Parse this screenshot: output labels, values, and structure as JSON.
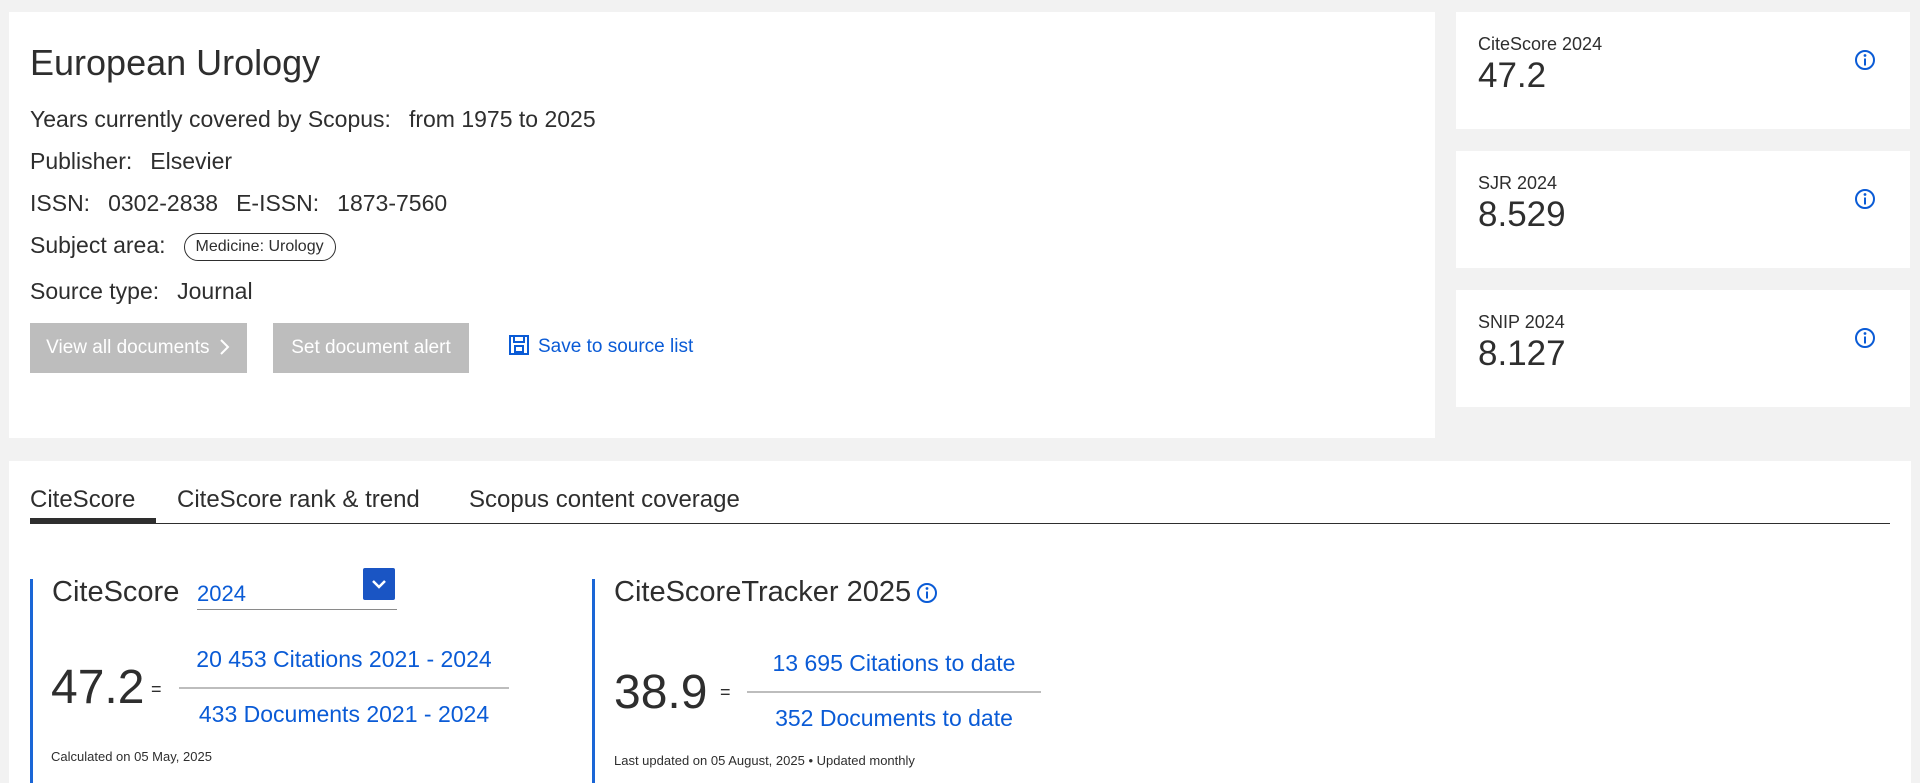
{
  "source": {
    "title": "European Urology",
    "years_label": "Years currently covered by Scopus:",
    "years_value": "from 1975 to 2025",
    "publisher_label": "Publisher:",
    "publisher_value": "Elsevier",
    "issn_label": "ISSN:",
    "issn_value": "0302-2838",
    "eissn_label": "E-ISSN:",
    "eissn_value": "1873-7560",
    "subject_label": "Subject area:",
    "subject_value": "Medicine: Urology",
    "source_type_label": "Source type:",
    "source_type_value": "Journal",
    "view_all_label": "View all documents",
    "set_alert_label": "Set document alert",
    "save_label": "Save to source list"
  },
  "metrics": [
    {
      "label": "CiteScore 2024",
      "value": "47.2"
    },
    {
      "label": "SJR 2024",
      "value": "8.529"
    },
    {
      "label": "SNIP 2024",
      "value": "8.127"
    }
  ],
  "tabs": [
    {
      "label": "CiteScore"
    },
    {
      "label": "CiteScore rank & trend"
    },
    {
      "label": "Scopus content coverage"
    }
  ],
  "citescore": {
    "title": "CiteScore",
    "selected_year": "2024",
    "value": "47.2",
    "equals": "=",
    "numerator": "20 453 Citations 2021 - 2024",
    "denominator": "433 Documents 2021 - 2024",
    "note": "Calculated on 05 May, 2025"
  },
  "tracker": {
    "title": "CiteScoreTracker 2025",
    "value": "38.9",
    "equals": "=",
    "numerator": "13 695 Citations to date",
    "denominator": "352 Documents to date",
    "note": "Last updated on 05 August, 2025 • Updated monthly"
  },
  "colors": {
    "accent": "#0a5bd6",
    "disabled_button": "#bdbdbd",
    "section_bar": "#1a66d6"
  }
}
